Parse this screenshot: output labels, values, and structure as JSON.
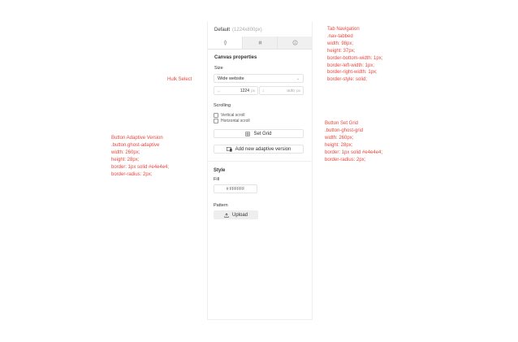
{
  "annotations": {
    "hulk": "Hulk Select",
    "tab_nav": "Tab Navigation\n.nav-tabbed\nwidth: 98px;\nheight: 37px;\nborder-bottom-width: 1px;\nborder-left-width: 1px;\nborder-right-width: 1px;\nborder-style: solid;",
    "adaptive": "Button Adaptive Version\n.button.ghost-adaptive\nwidth: 260px;\nheight: 28px;\nborder: 1px solid #e4e4e4;\nborder-radius: 2px;",
    "set_grid": "Button Set Grid\n.button-ghost-grid\nwidth: 260px;\nheight: 28px;\nborder: 1px solid #e4e4e4;\nborder-radius: 2px;"
  },
  "panel": {
    "title": "Default",
    "size_text": "(1224x800px)",
    "tabs": [
      {
        "icon": "pin-icon"
      },
      {
        "icon": "hash-icon"
      },
      {
        "icon": "info-icon"
      }
    ],
    "canvas_properties": "Canvas properties",
    "size_label": "Size",
    "size_select": "Wide website",
    "width_value": "1224",
    "width_unit": "px",
    "height_value": "auto",
    "height_unit": "px",
    "scrolling_label": "Scrolling",
    "vertical_scroll": "Vertical scroll",
    "horizontal_scroll": "Horizontal scroll",
    "set_grid": "Set Grid",
    "add_adaptive": "Add new adaptive version",
    "style_label": "Style",
    "fill_label": "Fill",
    "fill_value": "# FFFFFF",
    "pattern_label": "Pattern",
    "upload": "Upload"
  },
  "colors": {
    "annotation": "#e8483f",
    "border": "#e4e4e4",
    "tab_inactive": "#f0f0f0"
  }
}
